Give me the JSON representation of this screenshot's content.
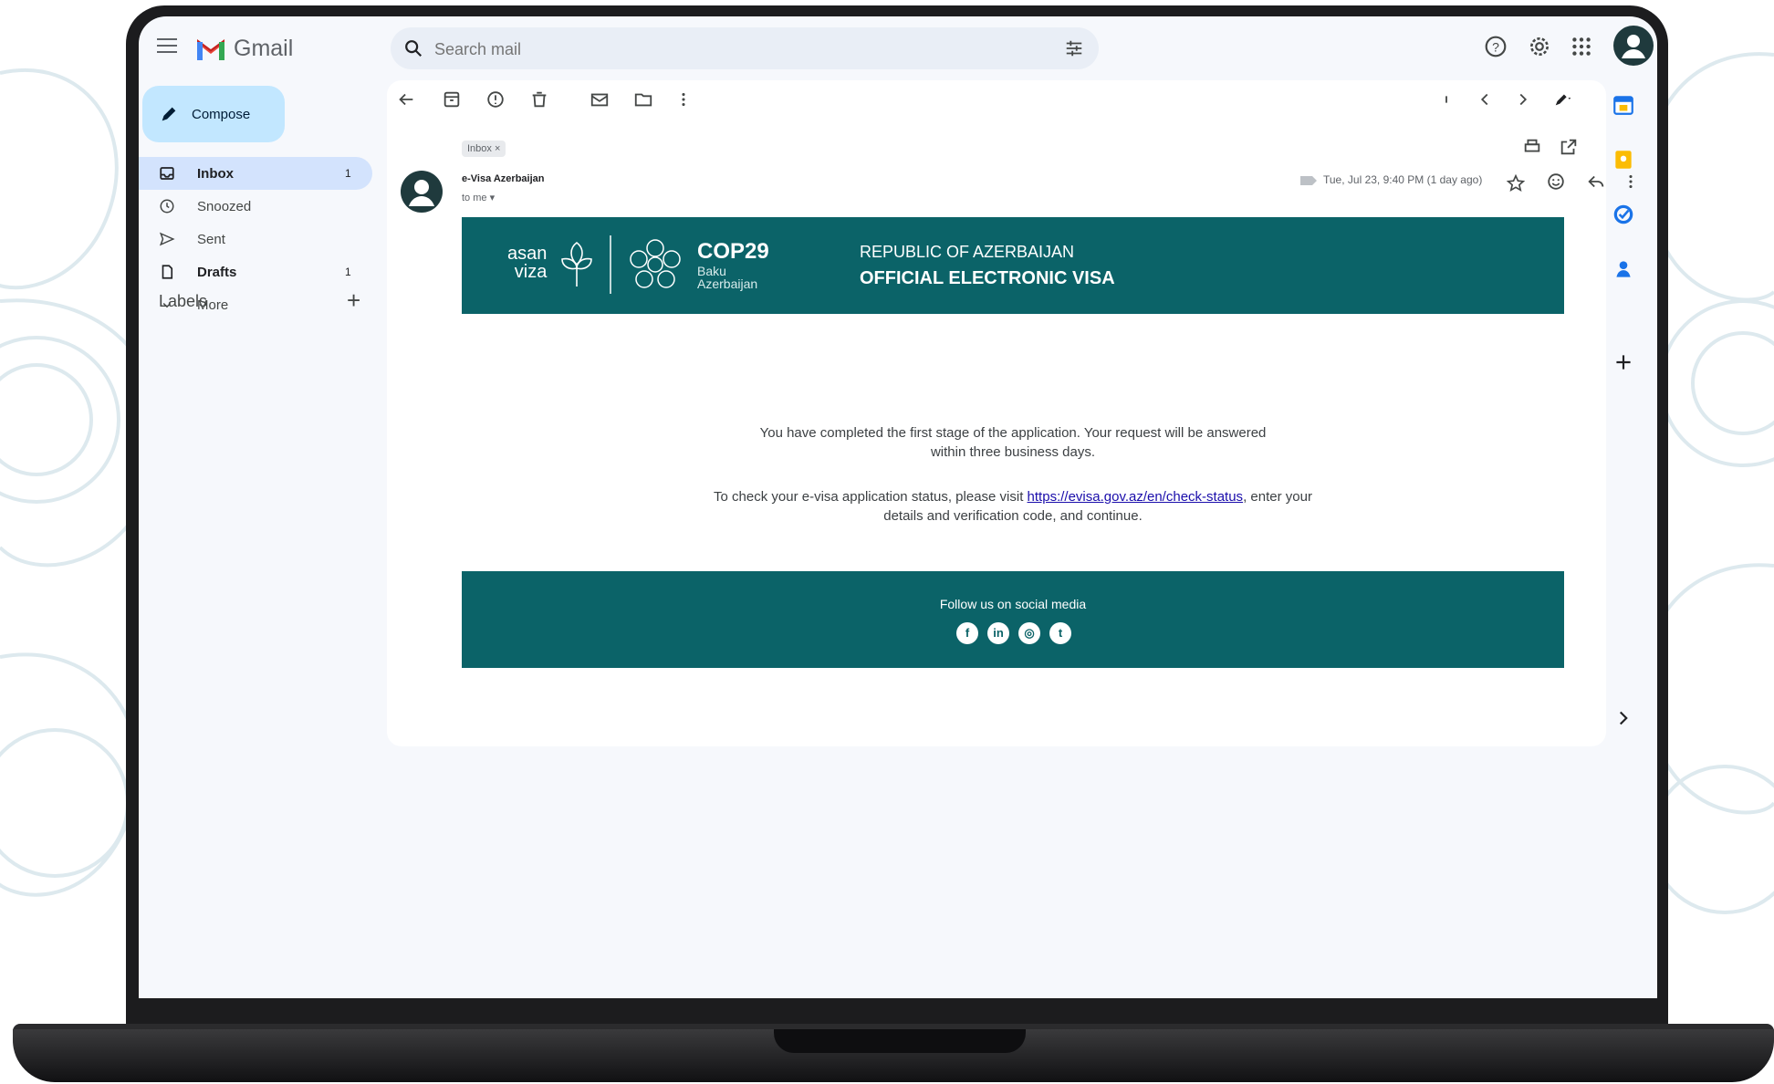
{
  "gmail": {
    "brand": "Gmail",
    "search_placeholder": "Search mail"
  },
  "sidebar": {
    "compose_label": "Compose",
    "items": [
      {
        "label": "Inbox",
        "count": "1"
      },
      {
        "label": "Snoozed",
        "count": ""
      },
      {
        "label": "Sent",
        "count": ""
      },
      {
        "label": "Drafts",
        "count": "1"
      },
      {
        "label": "More",
        "count": ""
      }
    ],
    "labels_heading": "Labels",
    "labels_add": "+"
  },
  "email": {
    "chip": "Inbox ×",
    "sender": "e-Visa Azerbaijan",
    "to": "to me ▾",
    "date": "Tue, Jul 23, 9:40 PM (1 day ago)",
    "banner": {
      "asan_line1": "asan",
      "asan_line2": "viza",
      "cop_title": "COP29",
      "cop_sub1": "Baku",
      "cop_sub2": "Azerbaijan",
      "republic": "REPUBLIC OF AZERBAIJAN",
      "official": "OFFICIAL ELECTRONIC VISA"
    },
    "para1_line1": "You have completed the first stage of the application. Your request will be answered",
    "para1_line2": "within three business days.",
    "para2_prefix": "To check your e-visa application status, please visit ",
    "para2_link": "https://evisa.gov.az/en/check-status",
    "para2_suffix": ", enter your",
    "para2_line2": "details and verification code, and continue.",
    "footer_text": "Follow us on social media"
  },
  "colors": {
    "brand_teal": "#0b6368",
    "compose_bg": "#c2e7ff",
    "inbox_active": "#d3e3fd"
  },
  "icons": [
    "menu-icon",
    "gmail-logo",
    "search-icon",
    "tune-icon",
    "help-icon",
    "settings-icon",
    "apps-icon",
    "account-avatar",
    "back-icon",
    "archive-icon",
    "report-icon",
    "delete-icon",
    "mark-unread-icon",
    "move-to-icon",
    "more-icon",
    "newer-icon",
    "older-icon",
    "print-icon",
    "open-new-window-icon",
    "star-icon",
    "emoji-icon",
    "reply-icon",
    "calendar-icon",
    "keep-icon",
    "tasks-icon",
    "contacts-icon",
    "add-icon",
    "expand-icon",
    "facebook-icon",
    "linkedin-icon",
    "instagram-icon",
    "twitter-icon"
  ]
}
